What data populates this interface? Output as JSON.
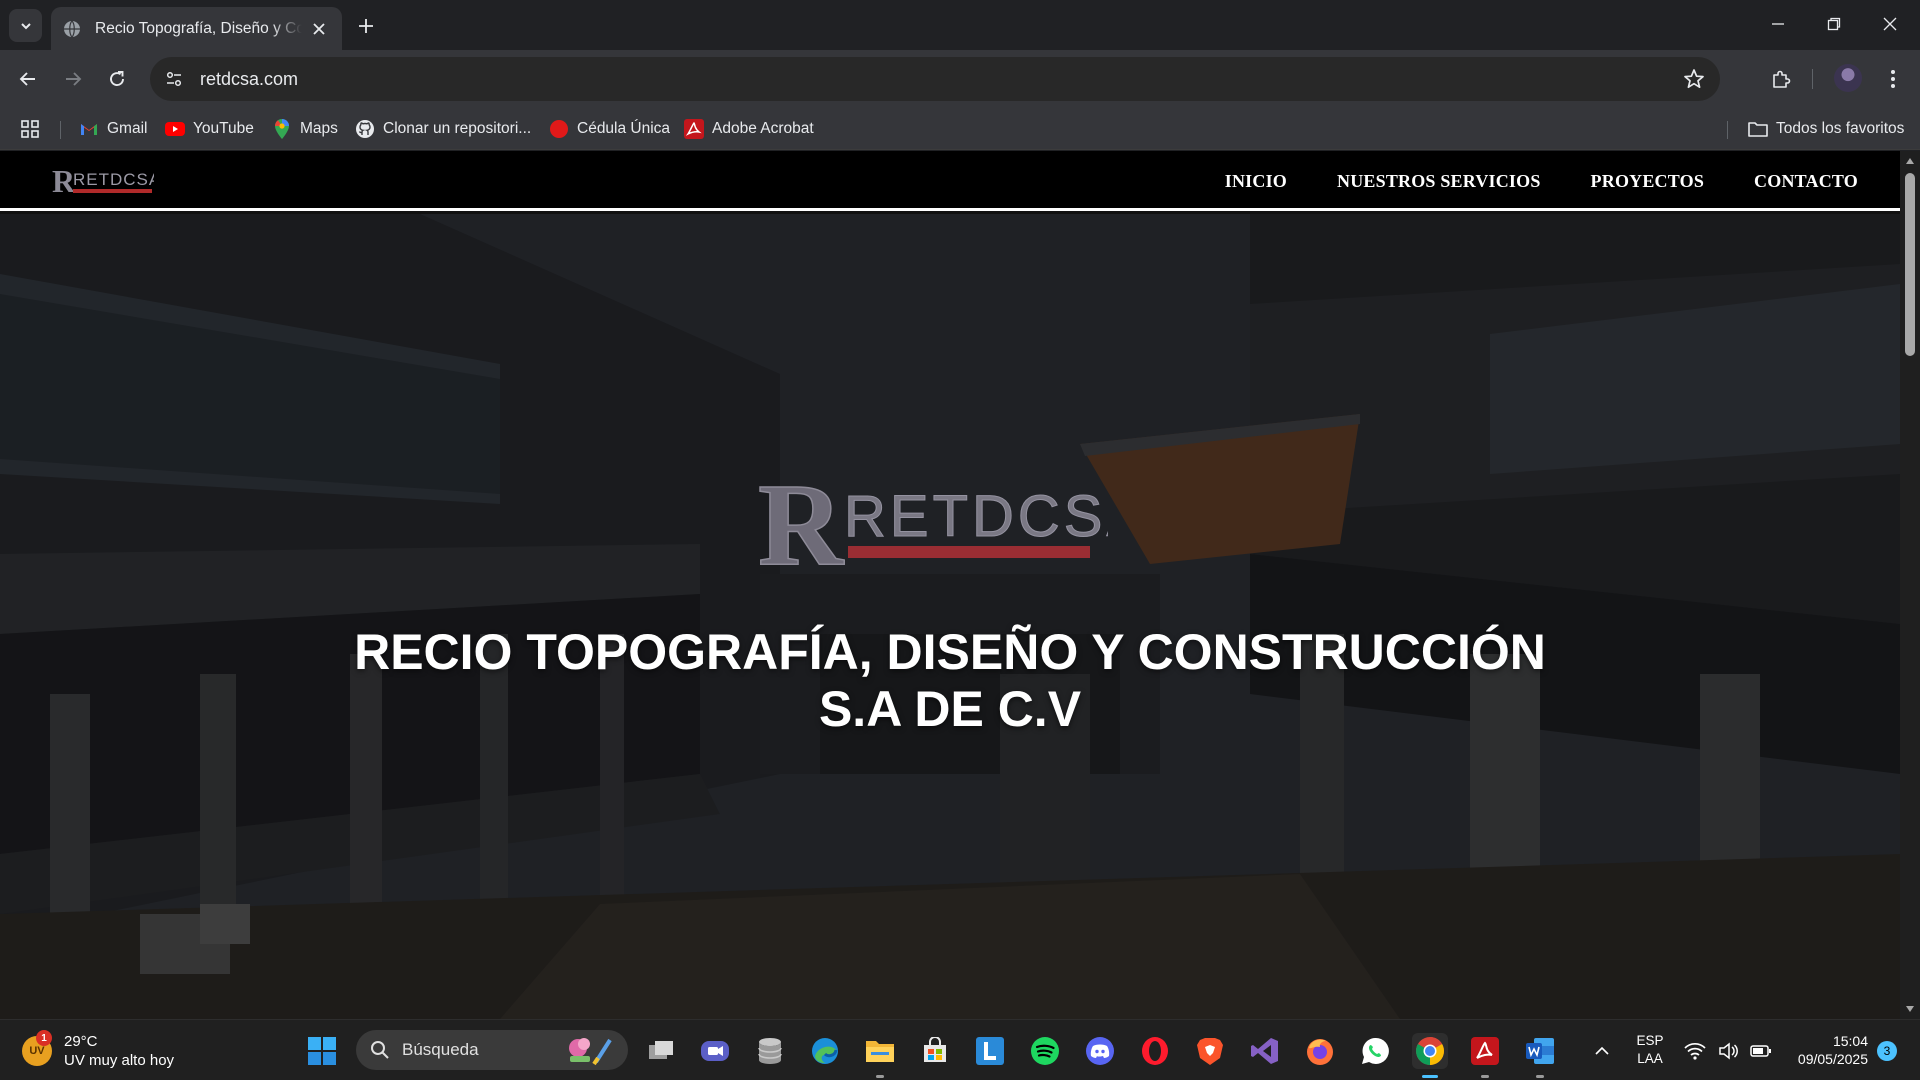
{
  "browser": {
    "tab_title": "Recio Topografía, Diseño y Construcción S.A de C.V",
    "url": "retdcsa.com",
    "bookmarks": [
      {
        "label": "Gmail",
        "icon": "gmail-icon"
      },
      {
        "label": "YouTube",
        "icon": "youtube-icon"
      },
      {
        "label": "Maps",
        "icon": "maps-icon"
      },
      {
        "label": "Clonar un repositori...",
        "icon": "github-icon"
      },
      {
        "label": "Cédula Única",
        "icon": "red-dot-icon"
      },
      {
        "label": "Adobe Acrobat",
        "icon": "acrobat-icon"
      }
    ],
    "all_bookmarks_label": "Todos los favoritos"
  },
  "site": {
    "logo_text": "RETDCSA",
    "nav": [
      "INICIO",
      "NUESTROS SERVICIOS",
      "PROYECTOS",
      "CONTACTO"
    ],
    "hero_title_line1": "RECIO TOPOGRAFÍA, DISEÑO Y CONSTRUCCIÓN",
    "hero_title_line2": "S.A DE C.V"
  },
  "taskbar": {
    "weather_temp": "29°C",
    "weather_desc": "UV muy alto hoy",
    "weather_badge": "1",
    "weather_icon_text": "UV",
    "search_placeholder": "Búsqueda",
    "apps": [
      "task-view",
      "meet",
      "database",
      "edge",
      "file-explorer",
      "store",
      "l-app",
      "spotify",
      "discord",
      "opera",
      "brave",
      "visual-studio",
      "firefox",
      "whatsapp",
      "chrome",
      "acrobat",
      "word"
    ],
    "language": "ESP",
    "keyboard": "LAA",
    "time": "15:04",
    "date": "09/05/2025",
    "notification_count": "3"
  },
  "colors": {
    "brand_red": "#c0392b",
    "nav_bg": "#000000",
    "chrome_dark": "#202124",
    "chrome_toolbar": "#35363a",
    "accent_blue": "#4cc2ff"
  }
}
